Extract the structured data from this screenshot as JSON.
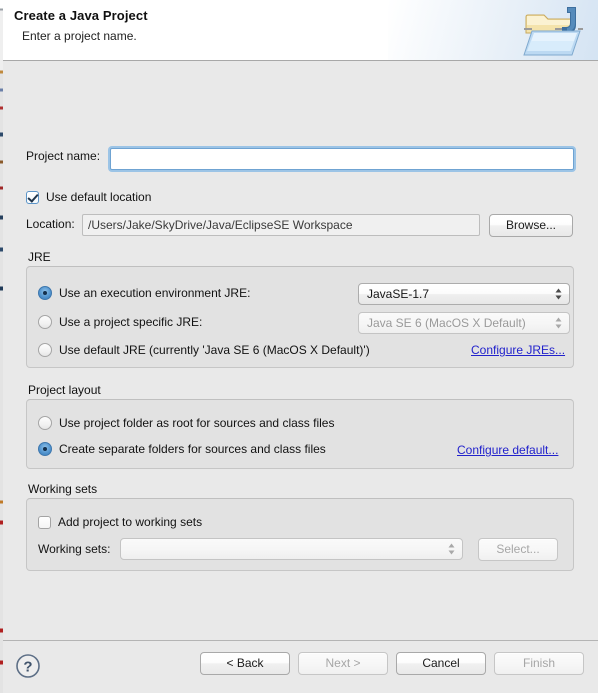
{
  "window": {
    "title": "Create a Java Project",
    "subtitle": "Enter a project name.",
    "header_icon": "java-project-folder-icon"
  },
  "form": {
    "project_name": {
      "label": "Project name:",
      "value": "",
      "placeholder": "",
      "focused": true
    },
    "use_default_location": {
      "label": "Use default location",
      "checked": true
    },
    "location": {
      "label": "Location:",
      "value": "/Users/Jake/SkyDrive/Java/EclipseSE Workspace",
      "browse_label": "Browse..."
    }
  },
  "jre": {
    "group_label": "JRE",
    "options": [
      {
        "label": "Use an execution environment JRE:",
        "selected": true,
        "combo_value": "JavaSE-1.7",
        "combo_disabled": false
      },
      {
        "label": "Use a project specific JRE:",
        "selected": false,
        "combo_value": "Java SE 6 (MacOS X Default)",
        "combo_disabled": true
      },
      {
        "label": "Use default JRE (currently 'Java SE 6 (MacOS X Default)')",
        "selected": false
      }
    ],
    "configure_link": "Configure JREs..."
  },
  "project_layout": {
    "group_label": "Project layout",
    "options": [
      {
        "label": "Use project folder as root for sources and class files",
        "selected": false
      },
      {
        "label": "Create separate folders for sources and class files",
        "selected": true
      }
    ],
    "configure_link": "Configure default..."
  },
  "working_sets": {
    "group_label": "Working sets",
    "add_checkbox": {
      "label": "Add project to working sets",
      "checked": false
    },
    "combo_label": "Working sets:",
    "combo_value": "",
    "select_label": "Select..."
  },
  "footer": {
    "help_icon": "help-question-icon",
    "buttons": [
      {
        "label": "< Back",
        "disabled": false,
        "default": false
      },
      {
        "label": "Next >",
        "disabled": true,
        "default": false
      },
      {
        "label": "Cancel",
        "disabled": false,
        "default": false
      },
      {
        "label": "Finish",
        "disabled": true,
        "default": false
      }
    ]
  },
  "colors": {
    "accent_link": "#2222cc",
    "focus_ring": "#9cc4e6",
    "radio_selected": "#4f92cd",
    "dialog_bg": "#e9e9e9",
    "group_bg": "#e2e2e2",
    "header_bg": "#ffffff"
  }
}
